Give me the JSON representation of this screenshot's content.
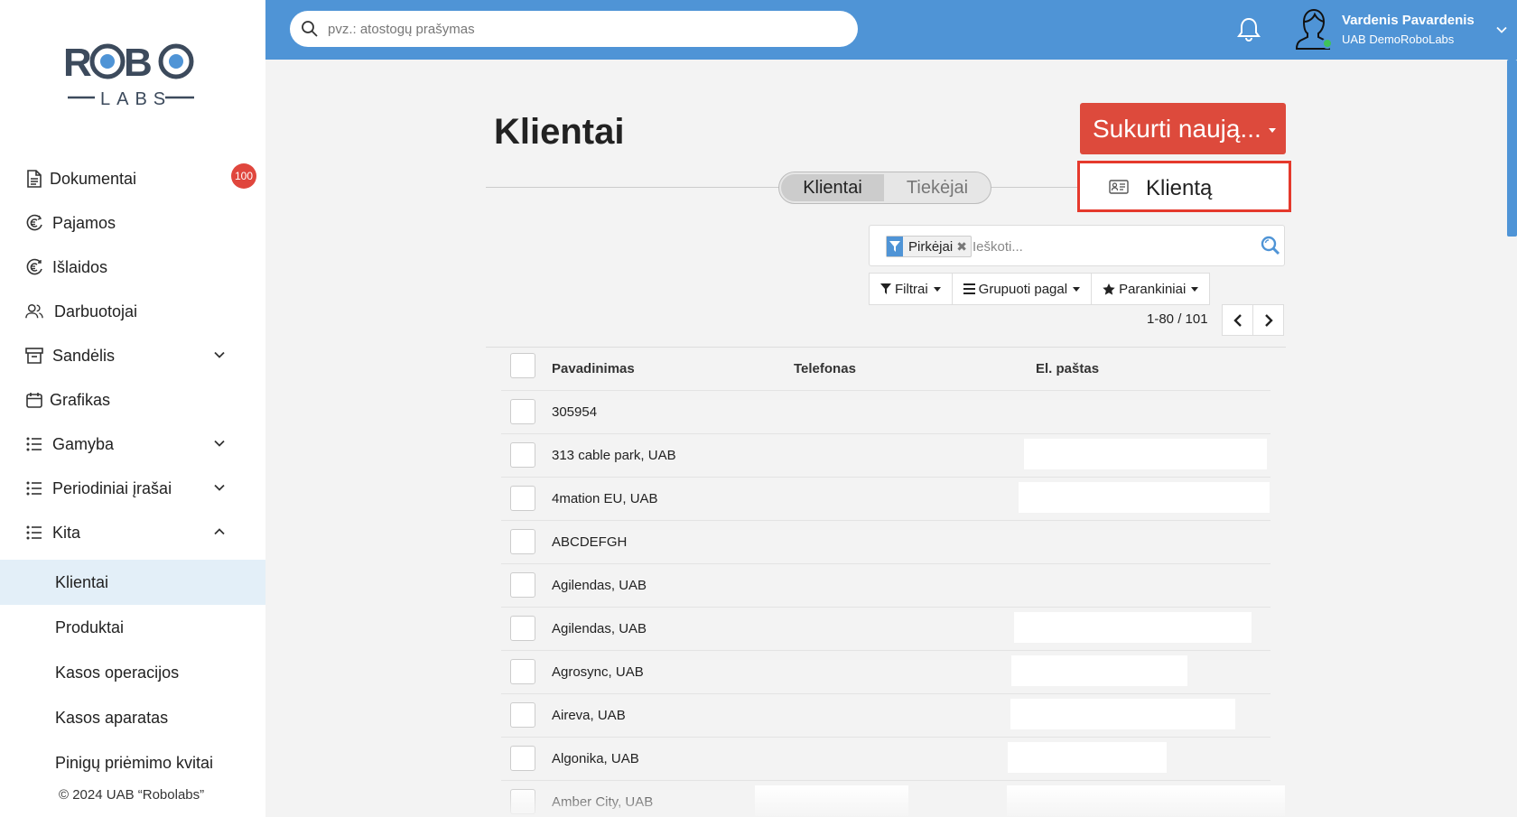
{
  "sidebar": {
    "logo_text": "ROBO",
    "logo_sub": "LABS",
    "items": [
      {
        "label": "Dokumentai",
        "icon": "document-icon",
        "badge": "100"
      },
      {
        "label": "Pajamos",
        "icon": "euro-income-icon"
      },
      {
        "label": "Išlaidos",
        "icon": "euro-expense-icon"
      },
      {
        "label": "Darbuotojai",
        "icon": "users-icon"
      },
      {
        "label": "Sandėlis",
        "icon": "archive-icon",
        "expandable": true
      },
      {
        "label": "Grafikas",
        "icon": "calendar-icon"
      },
      {
        "label": "Gamyba",
        "icon": "list-icon",
        "expandable": true
      },
      {
        "label": "Periodiniai įrašai",
        "icon": "list-icon",
        "expandable": true
      },
      {
        "label": "Kita",
        "icon": "list-icon",
        "expanded": true
      }
    ],
    "sub_items": [
      "Klientai",
      "Produktai",
      "Kasos operacijos",
      "Kasos aparatas",
      "Pinigų priėmimo kvitai"
    ],
    "active_sub": "Klientai",
    "copyright": "© 2024 UAB “Robolabs”"
  },
  "topbar": {
    "search_placeholder": "pvz.: atostogų prašymas",
    "user_name": "Vardenis Pavardenis",
    "user_company": "UAB DemoRoboLabs"
  },
  "main": {
    "title": "Klientai",
    "create_button": "Sukurti naują...",
    "dropdown_item": "Klientą",
    "tabs": [
      {
        "label": "Klientai",
        "active": true
      },
      {
        "label": "Tiekėjai",
        "active": false
      }
    ],
    "facet": "Pirkėjai",
    "search_placeholder": "Ieškoti...",
    "buttons": {
      "filters": "Filtrai",
      "group_by": "Grupuoti pagal",
      "favorites": "Parankiniai"
    },
    "pager": "1-80 / 101",
    "columns": [
      "Pavadinimas",
      "Telefonas",
      "El. paštas"
    ],
    "rows": [
      "305954",
      "313 cable park, UAB",
      "4mation EU, UAB",
      "ABCDEFGH",
      "Agilendas, UAB",
      "Agilendas, UAB",
      "Agrosync, UAB",
      "Aireva, UAB",
      "Algonika, UAB",
      "Amber City, UAB"
    ]
  },
  "colors": {
    "topbar": "#4f94d6",
    "accent_red": "#dd4a3c",
    "highlight_border": "#e5392c",
    "active_nav": "#e3eff8"
  }
}
